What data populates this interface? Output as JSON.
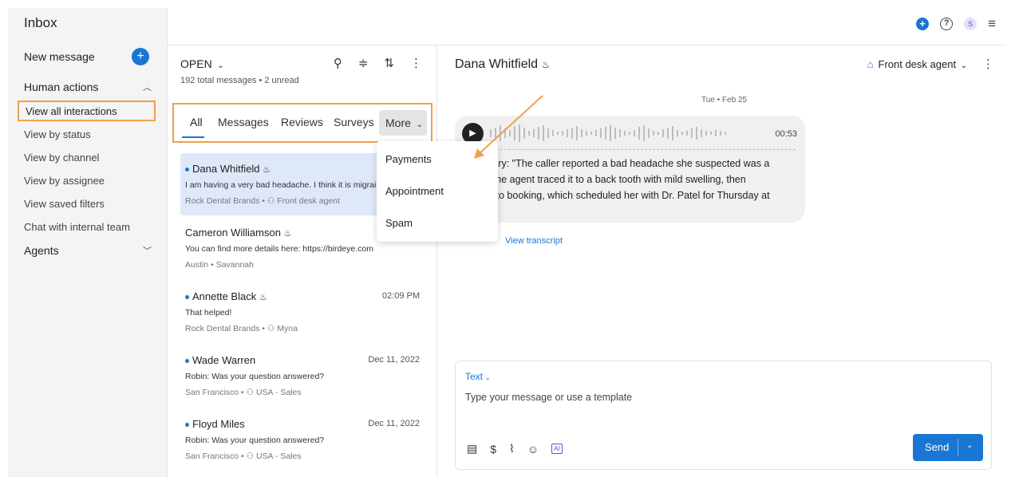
{
  "sidebar": {
    "title": "Inbox",
    "new_message": "New message",
    "new_message_icon": "+",
    "human_actions": "Human actions",
    "items": [
      {
        "label": "View all interactions"
      },
      {
        "label": "View by status"
      },
      {
        "label": "View by channel"
      },
      {
        "label": "View by assignee"
      },
      {
        "label": "View saved filters"
      },
      {
        "label": "Chat with internal team"
      }
    ],
    "agents": "Agents"
  },
  "topbar": {
    "avatar": "S",
    "icons": [
      "plus-icon",
      "help-icon",
      "avatar",
      "menu-icon"
    ]
  },
  "list": {
    "status": "OPEN",
    "total": "192 total messages • 2 unread",
    "tabs": [
      "All",
      "Messages",
      "Reviews",
      "Surveys",
      "More"
    ],
    "items": [
      {
        "name": "Dana Whitfield",
        "unread": true,
        "time": "",
        "preview": "I am having a very bad headache. I think it is migrai",
        "meta": "Rock Dental Brands • ",
        "meta2": "Front desk agent"
      },
      {
        "name": "Cameron Williamson",
        "unread": false,
        "time": "",
        "preview": "You can find more details here: https://birdeye.com",
        "meta": "Austin • Savannah",
        "meta2": ""
      },
      {
        "name": "Annette Black",
        "unread": true,
        "time": "02:09 PM",
        "preview": "That helped!",
        "meta": "Rock Dental Brands • ",
        "meta2": "Myna"
      },
      {
        "name": "Wade Warren",
        "unread": true,
        "time": "Dec 11, 2022",
        "preview": "Robin: Was your question answered?",
        "meta": "San Francisco • ",
        "meta2": "USA - Sales"
      },
      {
        "name": "Floyd Miles",
        "unread": true,
        "time": "Dec 11, 2022",
        "preview": "Robin: Was your question answered?",
        "meta": "San Francisco • ",
        "meta2": "USA - Sales"
      }
    ]
  },
  "dropdown": {
    "options": [
      "Payments",
      "Appointment",
      "Spam"
    ]
  },
  "conversation": {
    "title": "Dana Whitfield",
    "agent": "Front desk agent",
    "date": "Tue • Feb 25",
    "duration": "00:53",
    "summary_lines": [
      "nmary: \"The caller reported a bad headache she suspected was a",
      "e. The agent traced it to a back tooth with mild swelling, then",
      "ner to booking, which scheduled her with Dr. Patel for Thursday at"
    ],
    "view_transcript": "View transcript"
  },
  "composer": {
    "mode": "Text",
    "placeholder": "Type your message or use a template",
    "send": "Send"
  },
  "colors": {
    "accent": "#1976d2",
    "highlight_border": "#f0a04b",
    "selected_bg": "#dfe8f8"
  }
}
